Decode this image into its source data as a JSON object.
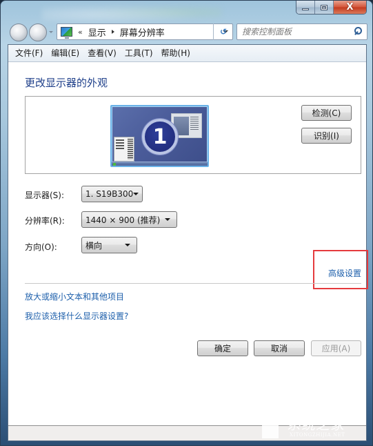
{
  "window": {
    "caption_buttons": {
      "minimize_icon": "minimize-icon",
      "maximize_icon": "maximize-icon",
      "close_glyph": "X"
    }
  },
  "navigation": {
    "back_icon": "back-arrow-icon",
    "forward_icon": "forward-arrow-icon",
    "address": {
      "icon": "display-control-panel-icon",
      "overflow_chevron": "«",
      "breadcrumbs": [
        "显示",
        "屏幕分辨率"
      ]
    },
    "refresh_glyph": "↺"
  },
  "search": {
    "placeholder": "搜索控制面板",
    "value": ""
  },
  "menubar": {
    "items": [
      "文件(F)",
      "编辑(E)",
      "查看(V)",
      "工具(T)",
      "帮助(H)"
    ]
  },
  "main": {
    "heading": "更改显示器的外观",
    "preview": {
      "monitor_number": "1"
    },
    "buttons": {
      "detect": "检测(C)",
      "identify": "识别(I)"
    },
    "fields": {
      "display_label": "显示器(S):",
      "display_value": "1. S19B300",
      "resolution_label": "分辨率(R):",
      "resolution_value": "1440 × 900 (推荐)",
      "orientation_label": "方向(O):",
      "orientation_value": "横向"
    },
    "advanced_link": "高级设置",
    "highlight_color": "#e53a3d",
    "links": {
      "zoom_text": "放大或缩小文本和其他项目",
      "which_settings": "我应该选择什么显示器设置?"
    },
    "dialog_buttons": {
      "ok": "确定",
      "cancel": "取消",
      "apply": "应用(A)"
    }
  },
  "watermark": {
    "cn": "系统之家",
    "en": "XITONGZHIJIA.NET"
  }
}
